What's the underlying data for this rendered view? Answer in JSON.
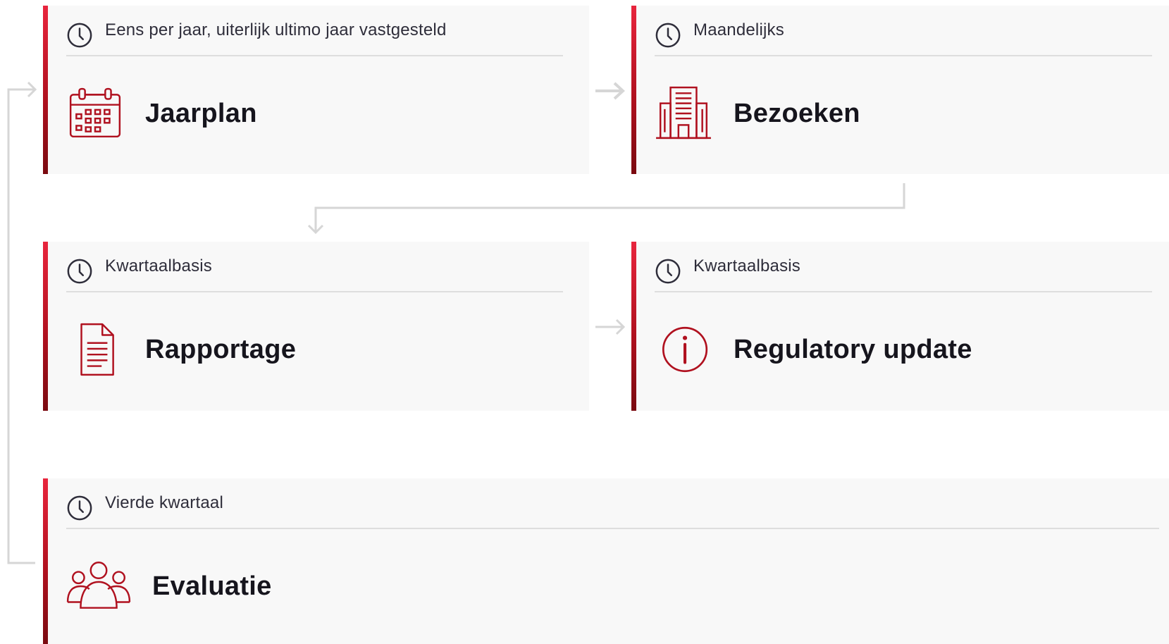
{
  "colors": {
    "accent_top": "#e8253d",
    "accent_bottom": "#7a0a10",
    "icon": "#b0111f",
    "card_background": "#f8f8f8",
    "connector": "#d6d6d6"
  },
  "cards": [
    {
      "frequency": "Eens per jaar, uiterlijk ultimo jaar vastgesteld",
      "title": "Jaarplan",
      "icon": "calendar-icon"
    },
    {
      "frequency": "Maandelijks",
      "title": "Bezoeken",
      "icon": "building-icon"
    },
    {
      "frequency": "Kwartaalbasis",
      "title": "Rapportage",
      "icon": "document-icon"
    },
    {
      "frequency": "Kwartaalbasis",
      "title": "Regulatory update",
      "icon": "info-icon"
    },
    {
      "frequency": "Vierde kwartaal",
      "title": "Evaluatie",
      "icon": "group-icon"
    }
  ],
  "flow": [
    {
      "from": "Jaarplan",
      "to": "Bezoeken"
    },
    {
      "from": "Bezoeken",
      "to": "Rapportage"
    },
    {
      "from": "Rapportage",
      "to": "Regulatory update"
    },
    {
      "from": "Evaluatie",
      "to": "Jaarplan"
    }
  ]
}
